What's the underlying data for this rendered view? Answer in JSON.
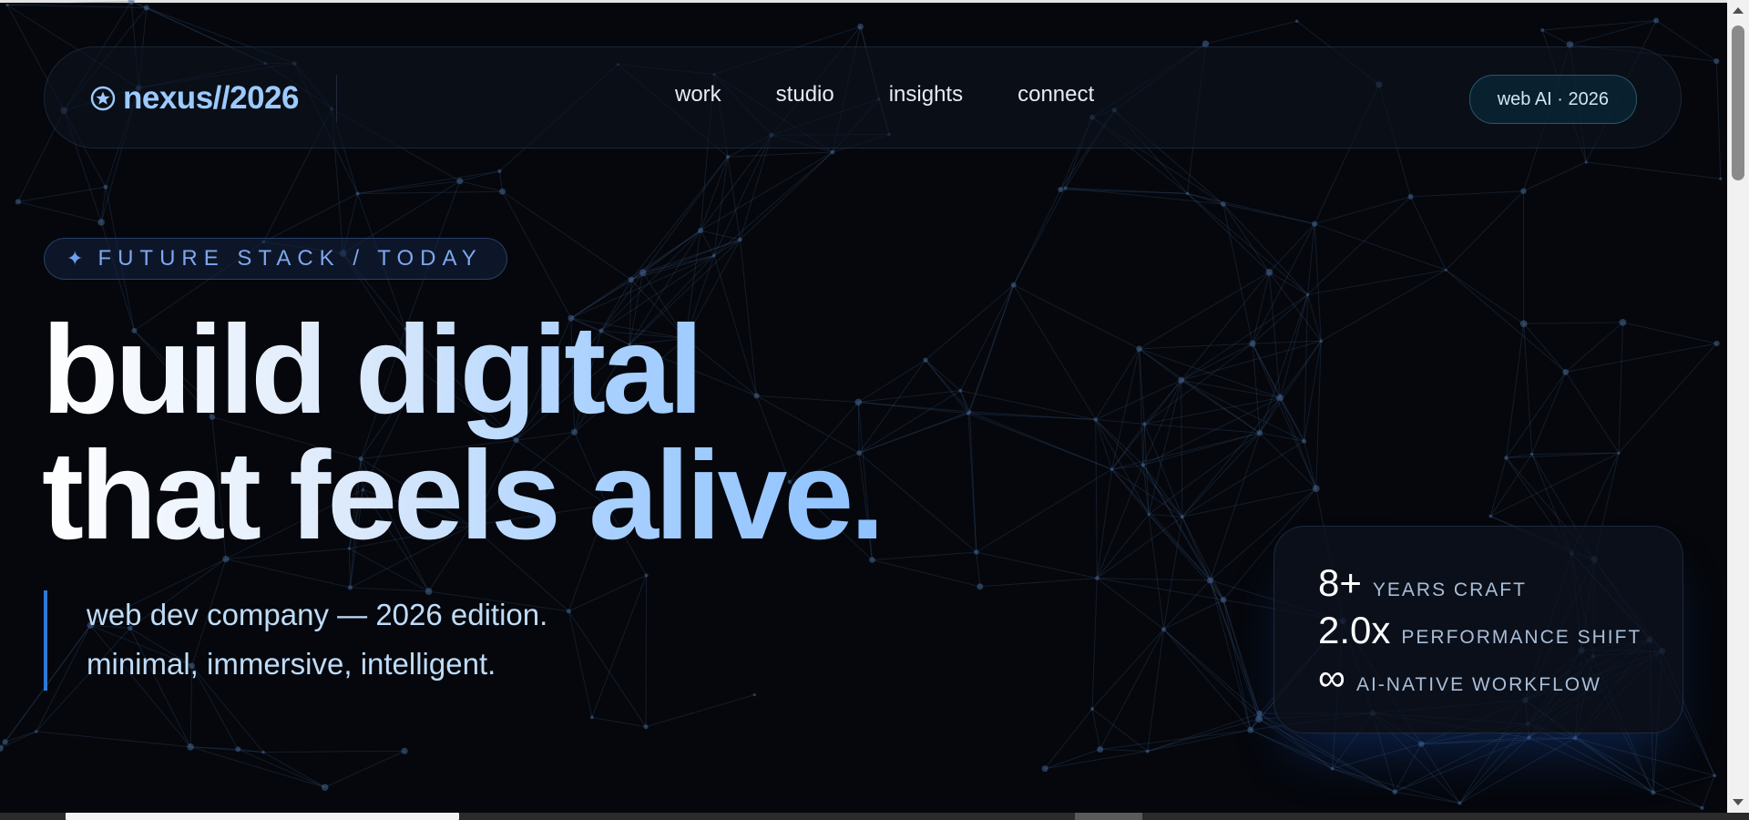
{
  "nav": {
    "logo": "nexus//2026",
    "links": [
      "work",
      "studio",
      "insights",
      "connect"
    ],
    "badge": "web AI · 2026"
  },
  "hero": {
    "tag_icon": "✦",
    "tag": "FUTURE STACK / TODAY",
    "headline": [
      "build digital",
      "that feels alive."
    ],
    "subcopy": [
      "web dev company — 2026 edition.",
      "minimal, immersive, intelligent."
    ]
  },
  "stats": [
    {
      "value": "8+",
      "label": "YEARS CRAFT"
    },
    {
      "value": "2.0x",
      "label": "PERFORMANCE SHIFT"
    },
    {
      "value": "∞",
      "label": "AI-NATIVE WORKFLOW"
    }
  ],
  "colors": {
    "background": "#05070c",
    "accent": "#9ccaff",
    "tag": "#7ea7ef",
    "subcopy_border": "#2f78d6"
  },
  "icons": [
    "star-circle-icon",
    "sparkle-icon"
  ]
}
